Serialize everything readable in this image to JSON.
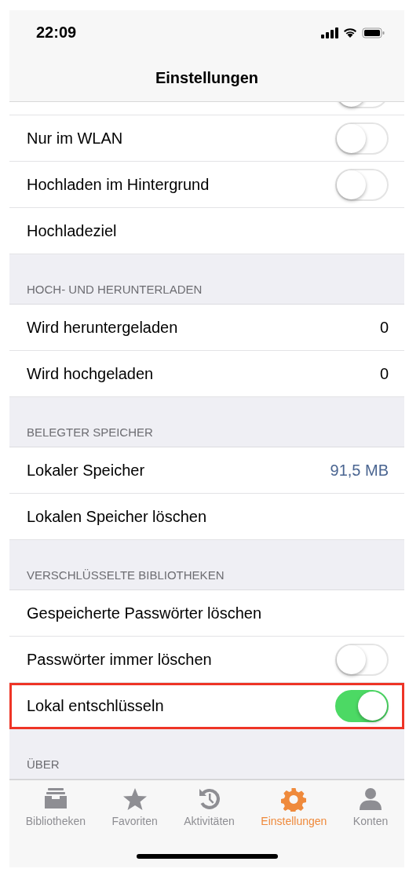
{
  "status_bar": {
    "time": "22:09"
  },
  "nav": {
    "title": "Einstellungen"
  },
  "sections": [
    {
      "rows": [
        {
          "kind": "toggle",
          "on": false,
          "highlighted": false
        },
        {
          "kind": "toggle",
          "label": "Nur im WLAN",
          "on": false,
          "highlighted": false
        },
        {
          "kind": "toggle",
          "label": "Hochladen im Hintergrund",
          "on": false,
          "highlighted": false
        },
        {
          "kind": "plain",
          "label": "Hochladeziel",
          "highlighted": false
        }
      ]
    },
    {
      "header": "HOCH- UND HERUNTERLADEN",
      "rows": [
        {
          "kind": "value",
          "label": "Wird heruntergeladen",
          "value": "0",
          "highlighted": false
        },
        {
          "kind": "value",
          "label": "Wird hochgeladen",
          "value": "0",
          "highlighted": false
        }
      ]
    },
    {
      "header": "BELEGTER SPEICHER",
      "rows": [
        {
          "kind": "value",
          "label": "Lokaler Speicher",
          "value": "91,5 MB",
          "color": "#4a6591",
          "highlighted": false
        },
        {
          "kind": "plain",
          "label": "Lokalen Speicher löschen",
          "highlighted": false
        }
      ]
    },
    {
      "header": "VERSCHLÜSSELTE BIBLIOTHEKEN",
      "rows": [
        {
          "kind": "plain",
          "label": "Gespeicherte Passwörter löschen",
          "highlighted": false
        },
        {
          "kind": "toggle",
          "label": "Passwörter immer löschen",
          "on": false,
          "highlighted": false
        },
        {
          "kind": "toggle",
          "label": "Lokal entschlüsseln",
          "on": true,
          "highlighted": true
        }
      ]
    },
    {
      "header": "ÜBER"
    }
  ],
  "tabs": [
    {
      "label": "Bibliotheken",
      "selected": false
    },
    {
      "label": "Favoriten",
      "selected": false
    },
    {
      "label": "Aktivitäten",
      "selected": false
    },
    {
      "label": "Einstellungen",
      "selected": true
    },
    {
      "label": "Konten",
      "selected": false
    }
  ]
}
